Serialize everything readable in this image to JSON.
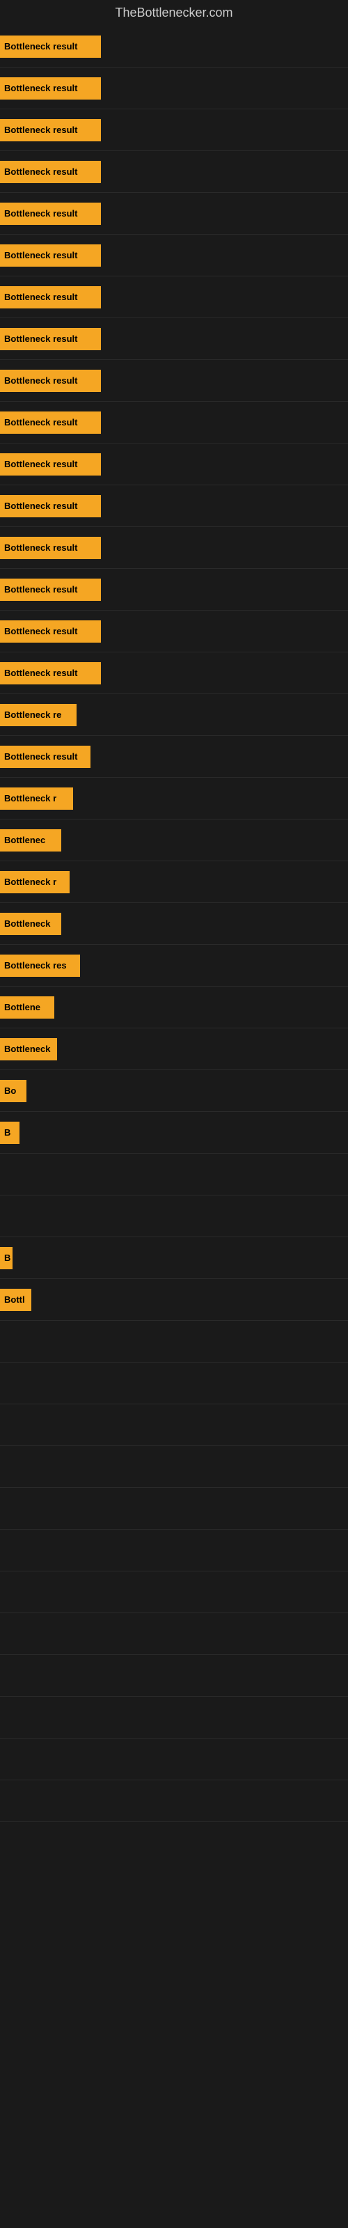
{
  "site": {
    "title": "TheBottlenecker.com"
  },
  "bars": [
    {
      "label": "Bottleneck result",
      "width": 145
    },
    {
      "label": "Bottleneck result",
      "width": 145
    },
    {
      "label": "Bottleneck result",
      "width": 145
    },
    {
      "label": "Bottleneck result",
      "width": 145
    },
    {
      "label": "Bottleneck result",
      "width": 145
    },
    {
      "label": "Bottleneck result",
      "width": 145
    },
    {
      "label": "Bottleneck result",
      "width": 145
    },
    {
      "label": "Bottleneck result",
      "width": 145
    },
    {
      "label": "Bottleneck result",
      "width": 145
    },
    {
      "label": "Bottleneck result",
      "width": 145
    },
    {
      "label": "Bottleneck result",
      "width": 145
    },
    {
      "label": "Bottleneck result",
      "width": 145
    },
    {
      "label": "Bottleneck result",
      "width": 145
    },
    {
      "label": "Bottleneck result",
      "width": 145
    },
    {
      "label": "Bottleneck result",
      "width": 145
    },
    {
      "label": "Bottleneck result",
      "width": 145
    },
    {
      "label": "Bottleneck re",
      "width": 110
    },
    {
      "label": "Bottleneck result",
      "width": 130
    },
    {
      "label": "Bottleneck r",
      "width": 105
    },
    {
      "label": "Bottlenec",
      "width": 88
    },
    {
      "label": "Bottleneck r",
      "width": 100
    },
    {
      "label": "Bottleneck",
      "width": 88
    },
    {
      "label": "Bottleneck res",
      "width": 115
    },
    {
      "label": "Bottlene",
      "width": 78
    },
    {
      "label": "Bottleneck",
      "width": 82
    },
    {
      "label": "Bo",
      "width": 38
    },
    {
      "label": "B",
      "width": 28
    },
    {
      "label": "",
      "width": 0
    },
    {
      "label": "",
      "width": 0
    },
    {
      "label": "B",
      "width": 18
    },
    {
      "label": "Bottl",
      "width": 45
    },
    {
      "label": "",
      "width": 0
    },
    {
      "label": "",
      "width": 0
    },
    {
      "label": "",
      "width": 0
    },
    {
      "label": "",
      "width": 0
    },
    {
      "label": "",
      "width": 0
    },
    {
      "label": "",
      "width": 0
    },
    {
      "label": "",
      "width": 0
    },
    {
      "label": "",
      "width": 0
    },
    {
      "label": "",
      "width": 0
    },
    {
      "label": "",
      "width": 0
    },
    {
      "label": "",
      "width": 0
    },
    {
      "label": "",
      "width": 0
    }
  ]
}
